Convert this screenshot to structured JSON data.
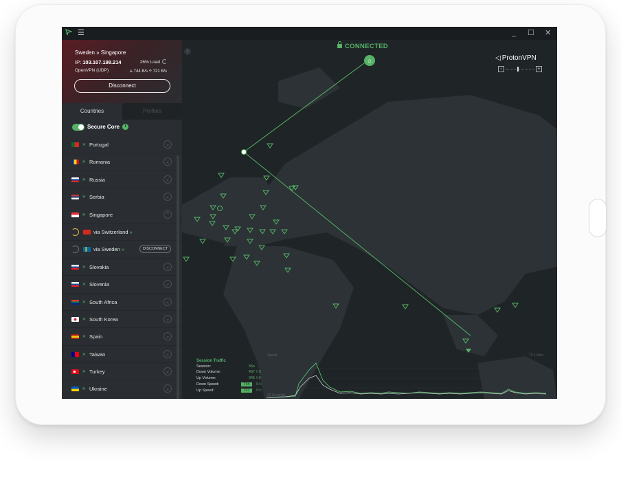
{
  "window": {
    "minimize": "_",
    "maximize": "☐",
    "close": "✕"
  },
  "connection": {
    "location": "Sweden » Singapore",
    "ip_label": "IP:",
    "ip": "103.107.198.214",
    "load": "26% Load",
    "protocol": "OpenVPN (UDP)",
    "speed": "🡫 744 B/s 🡩 721 B/s",
    "disconnect_label": "Disconnect"
  },
  "tabs": {
    "countries": "Countries",
    "profiles": "Profiles"
  },
  "secure_core": {
    "label": "Secure Core",
    "enabled": true
  },
  "countries": [
    {
      "name": "Portugal",
      "flag": "#c8102e"
    },
    {
      "name": "Romania",
      "flag": "#fcd116"
    },
    {
      "name": "Russia",
      "flag": "#0039a6"
    },
    {
      "name": "Serbia",
      "flag": "#c6363c"
    },
    {
      "name": "Singapore",
      "flag": "#ef3340",
      "expanded": true
    }
  ],
  "sub_servers": [
    {
      "label": "via Switzerland",
      "sep": "»",
      "flag": "#d52b1e",
      "state": "connecting"
    },
    {
      "label": "via Sweden",
      "sep": "»",
      "flag": "#006aa7",
      "state": "connected",
      "action": "DISCONNECT"
    }
  ],
  "countries_after": [
    {
      "name": "Slovakia",
      "flag": "#0b4ea2"
    },
    {
      "name": "Slovenia",
      "flag": "#005da4"
    },
    {
      "name": "South Africa",
      "flag": "#007a4d"
    },
    {
      "name": "South Korea",
      "flag": "#ffffff"
    },
    {
      "name": "Spain",
      "flag": "#f1bf00"
    },
    {
      "name": "Taiwan",
      "flag": "#fe0000"
    },
    {
      "name": "Turkey",
      "flag": "#e30a17"
    },
    {
      "name": "Ukraine",
      "flag": "#ffd500"
    }
  ],
  "map": {
    "status": "CONNECTED",
    "brand": "ProtonVPN",
    "zoom_minus": "-",
    "zoom_plus": "+",
    "collapse": "‹",
    "home": "⌂"
  },
  "traffic": {
    "title": "Session Traffic",
    "rows": [
      {
        "label": "Session:",
        "value": "55s",
        "unit": ""
      },
      {
        "label": "Down Volume:",
        "value": "497",
        "unit": "KB"
      },
      {
        "label": "Up Volume:",
        "value": "345",
        "unit": "KB"
      },
      {
        "label": "Down Speed:",
        "value": "744",
        "unit": "B/s"
      },
      {
        "label": "Up Speed:",
        "value": "721",
        "unit": "B/s"
      }
    ],
    "speed_label": "Speed",
    "max_label": "72.1 Kb/s",
    "start_label": "60 Seconds",
    "end_label": "0"
  },
  "colors": {
    "accent": "#56b366",
    "map_bg": "#1f2427",
    "land": "#2c3236"
  }
}
